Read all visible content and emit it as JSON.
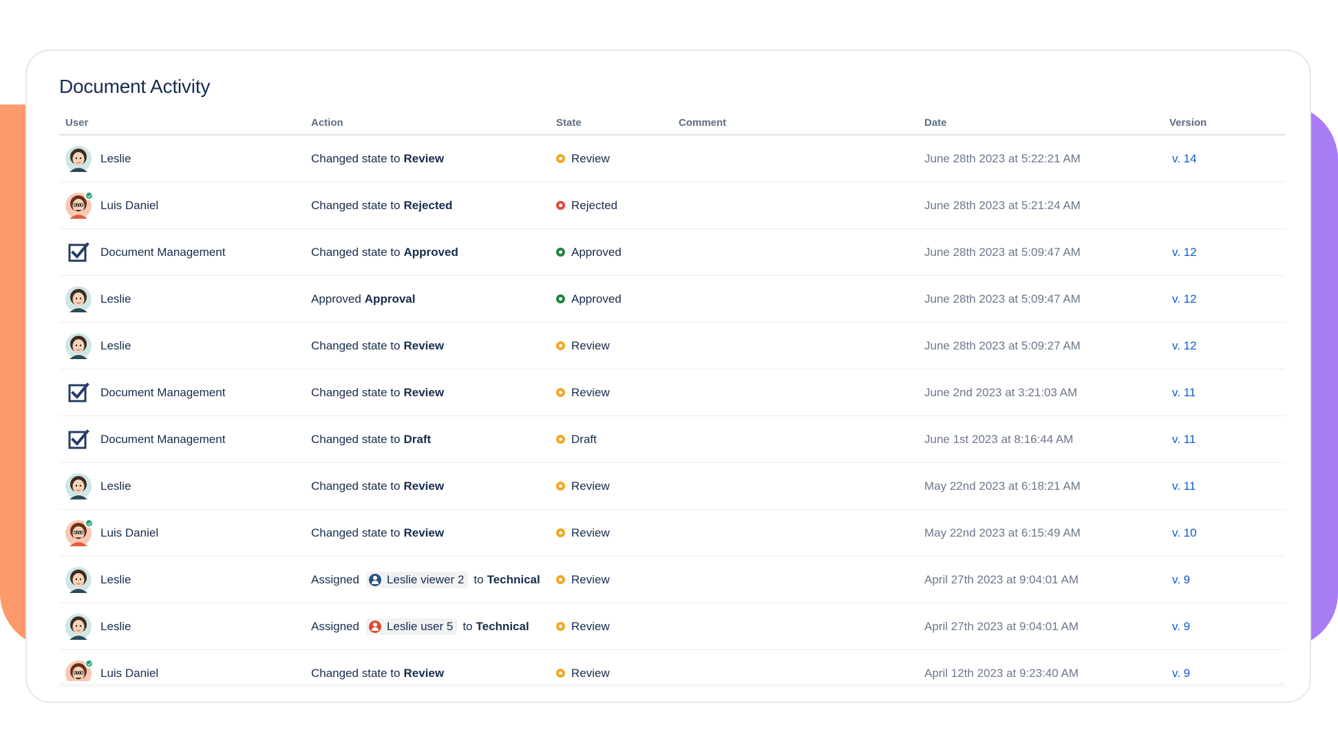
{
  "title": "Document Activity",
  "columns": {
    "user": "User",
    "action": "Action",
    "state": "State",
    "comment": "Comment",
    "date": "Date",
    "version": "Version"
  },
  "colors": {
    "review": "#f5a623",
    "rejected": "#e2483d",
    "approved": "#22863a",
    "link": "#0c5bd0",
    "left_blob": "#fd9a6b",
    "right_blob": "#a97bf5"
  },
  "rows": [
    {
      "user": "Leslie",
      "avatar": "leslie-avatar",
      "verb": "Changed state to",
      "target": "Review",
      "state": "Review",
      "state_class": "review",
      "comment": "",
      "date": "June 28th 2023 at 5:22:21 AM",
      "version": "v. 14"
    },
    {
      "user": "Luis Daniel",
      "avatar": "luis-avatar",
      "verb": "Changed state to",
      "target": "Rejected",
      "state": "Rejected",
      "state_class": "rejected",
      "comment": "",
      "date": "June 28th 2023 at 5:21:24 AM",
      "version": ""
    },
    {
      "user": "Document Management",
      "avatar": "document-management-icon",
      "verb": "Changed state to",
      "target": "Approved",
      "state": "Approved",
      "state_class": "approved",
      "comment": "",
      "date": "June 28th 2023 at 5:09:47 AM",
      "version": "v. 12"
    },
    {
      "user": "Leslie",
      "avatar": "leslie-avatar",
      "verb": "Approved",
      "target": "Approval",
      "state": "Approved",
      "state_class": "approved",
      "comment": "",
      "date": "June 28th 2023 at 5:09:47 AM",
      "version": "v. 12"
    },
    {
      "user": "Leslie",
      "avatar": "leslie-avatar",
      "verb": "Changed state to",
      "target": "Review",
      "state": "Review",
      "state_class": "review",
      "comment": "",
      "date": "June 28th 2023 at 5:09:27 AM",
      "version": "v. 12"
    },
    {
      "user": "Document Management",
      "avatar": "document-management-icon",
      "verb": "Changed state to",
      "target": "Review",
      "state": "Review",
      "state_class": "review",
      "comment": "",
      "date": "June 2nd 2023 at 3:21:03 AM",
      "version": "v. 11"
    },
    {
      "user": "Document Management",
      "avatar": "document-management-icon",
      "verb": "Changed state to",
      "target": "Draft",
      "state": "Draft",
      "state_class": "draft",
      "comment": "",
      "date": "June 1st 2023 at 8:16:44 AM",
      "version": "v. 11"
    },
    {
      "user": "Leslie",
      "avatar": "leslie-avatar",
      "verb": "Changed state to",
      "target": "Review",
      "state": "Review",
      "state_class": "review",
      "comment": "",
      "date": "May 22nd 2023 at 6:18:21 AM",
      "version": "v. 11"
    },
    {
      "user": "Luis Daniel",
      "avatar": "luis-avatar",
      "verb": "Changed state to",
      "target": "Review",
      "state": "Review",
      "state_class": "review",
      "comment": "",
      "date": "May 22nd 2023 at 6:15:49 AM",
      "version": "v. 10"
    },
    {
      "user": "Leslie",
      "avatar": "leslie-avatar",
      "verb": "Assigned",
      "mention": "Leslie viewer 2",
      "mention_icon": "user-icon-blue",
      "mention_suffix": "to",
      "target": "Technical",
      "state": "Review",
      "state_class": "review",
      "comment": "",
      "date": "April 27th 2023 at 9:04:01 AM",
      "version": "v. 9"
    },
    {
      "user": "Leslie",
      "avatar": "leslie-avatar",
      "verb": "Assigned",
      "mention": "Leslie user 5",
      "mention_icon": "user-icon-red",
      "mention_suffix": "to",
      "target": "Technical",
      "state": "Review",
      "state_class": "review",
      "comment": "",
      "date": "April 27th 2023 at 9:04:01 AM",
      "version": "v. 9"
    },
    {
      "user": "Luis Daniel",
      "avatar": "luis-avatar",
      "verb": "Changed state to",
      "target": "Review",
      "state": "Review",
      "state_class": "review",
      "comment": "",
      "date": "April 12th 2023 at 9:23:40 AM",
      "version": "v. 9"
    }
  ]
}
